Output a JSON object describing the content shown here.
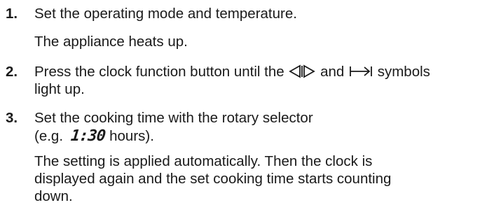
{
  "steps": [
    {
      "number": "1.",
      "text": "Set the operating mode and temperature.",
      "result": "The appliance heats up."
    },
    {
      "number": "2.",
      "text_before": "Press the clock function button until the",
      "text_middle": "and",
      "text_after": "symbols",
      "text_line2": "light up.",
      "icons": [
        "duration-arrows-icon",
        "end-time-arrow-icon"
      ]
    },
    {
      "number": "3.",
      "text_line1": "Set the cooking time with the rotary selector",
      "example_prefix": "(e.g.",
      "display_value": "1:30",
      "example_suffix": "hours).",
      "result_lines": [
        "The setting is applied automatically. Then the clock is",
        "displayed again and the set cooking time starts counting",
        "down."
      ]
    }
  ]
}
